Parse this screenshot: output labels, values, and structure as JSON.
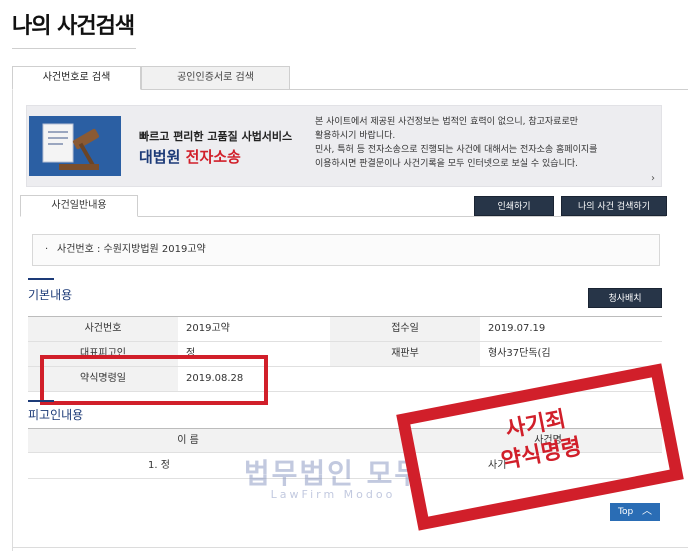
{
  "page": {
    "title": "나의 사건검색"
  },
  "tabs": [
    {
      "label": "사건번호로 검색",
      "active": true
    },
    {
      "label": "공인인증서로 검색",
      "active": false
    }
  ],
  "banner": {
    "subtitle": "빠르고 편리한 고품질 사법서비스",
    "brand_part1": "대법원",
    "brand_part2": "전자소송",
    "notice_line1": "본 사이트에서 제공된 사건정보는 법적인 효력이 없으니, 참고자료로만",
    "notice_line2": "활용하시기 바랍니다.",
    "notice_line3": "민사, 특허 등 전자소송으로 진행되는 사건에 대해서는 전자소송 홈페이지를",
    "notice_line4": "이용하시면 판결문이나 사건기록을 모두 인터넷으로 보실 수 있습니다.",
    "icon": "gavel-document-icon"
  },
  "subtab": {
    "label": "사건일반내용"
  },
  "buttons": {
    "print": "인쇄하기",
    "my_search": "나의 사건 검색하기",
    "clear": "청사배치",
    "top": "Top"
  },
  "case_number": {
    "text": "사건번호 : 수원지방법원 2019고약"
  },
  "basic_section": {
    "title": "기본내용"
  },
  "basic_table": {
    "rows": [
      {
        "h1": "사건번호",
        "v1": "2019고약",
        "h2": "접수일",
        "v2": "2019.07.19"
      },
      {
        "h1": "대표피고인",
        "v1": "정",
        "h2": "재판부",
        "v2": "형사37단독(김"
      },
      {
        "h1": "약식명령일",
        "v1": "2019.08.28",
        "h2": "",
        "v2": ""
      }
    ]
  },
  "defendant_section": {
    "title": "피고인내용"
  },
  "defendant_table": {
    "headers": [
      "이 름",
      "사건명"
    ],
    "rows": [
      {
        "name": "1. 정",
        "case": "사기"
      }
    ]
  },
  "watermark": {
    "main": "법무법인 모두",
    "sub": "LawFirm Modoo"
  },
  "stamp": {
    "line1": "사기죄",
    "line2": "약식명령"
  },
  "colors": {
    "navy": "#1d3b78",
    "red": "#d11f2a",
    "button_dark": "#273548",
    "top_blue": "#2a6db5"
  }
}
